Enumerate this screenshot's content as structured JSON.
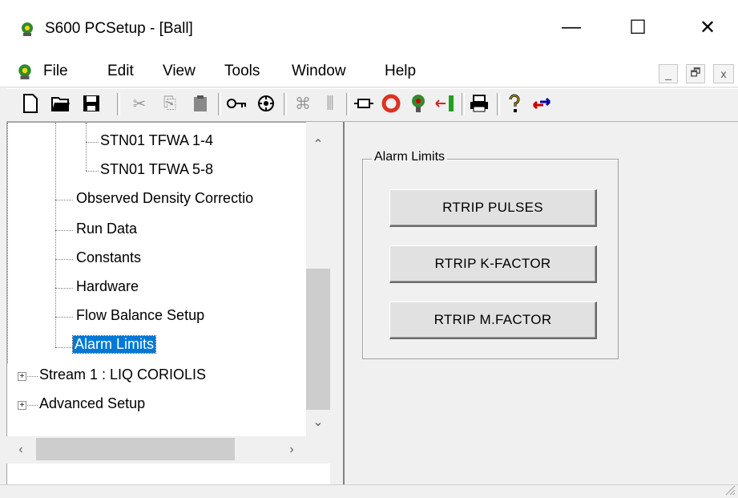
{
  "window": {
    "title": "S600 PCSetup  - [Ball]",
    "minimize": "—",
    "maximize": "☐",
    "close": "✕"
  },
  "menu": {
    "items": [
      "File",
      "Edit",
      "View",
      "Tools",
      "Window",
      "Help"
    ],
    "mdi_minimize": "_",
    "mdi_restore": "🗗",
    "mdi_close": "x"
  },
  "toolbar": {
    "icons": [
      "new-icon",
      "open-icon",
      "save-icon",
      "cut-icon",
      "copy-icon",
      "paste-icon",
      "key-icon",
      "config-icon",
      "network-icon",
      "adjust-icon",
      "connect-icon",
      "stop-icon",
      "go-icon",
      "transfer-icon",
      "print-icon",
      "help-icon",
      "swap-icon"
    ]
  },
  "tree": {
    "items": [
      {
        "label": "STN01 TFWA 1-4"
      },
      {
        "label": "STN01 TFWA 5-8"
      },
      {
        "label": "Observed Density Correctio"
      },
      {
        "label": "Run Data"
      },
      {
        "label": "Constants"
      },
      {
        "label": "Hardware"
      },
      {
        "label": "Flow Balance Setup"
      },
      {
        "label": "Alarm Limits",
        "selected": true
      },
      {
        "label": "Stream 1 : LIQ CORIOLIS"
      },
      {
        "label": "Advanced Setup"
      }
    ]
  },
  "panel": {
    "group_title": "Alarm Limits",
    "buttons": [
      "RTRIP PULSES",
      "RTRIP K-FACTOR",
      "RTRIP M.FACTOR"
    ]
  }
}
